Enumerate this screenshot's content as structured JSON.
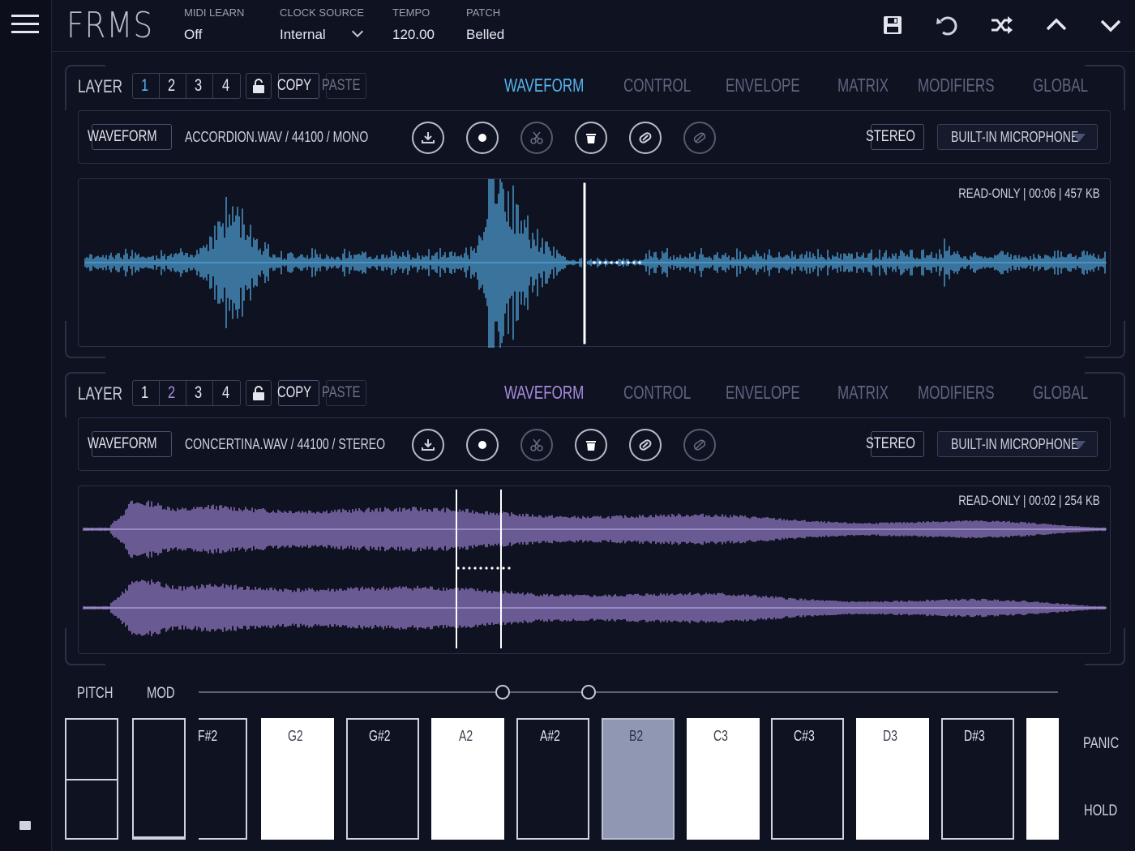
{
  "app": {
    "title": "FRMS"
  },
  "topbar": {
    "midi_learn": {
      "label": "MIDI LEARN",
      "value": "Off"
    },
    "clock_source": {
      "label": "CLOCK SOURCE",
      "value": "Internal"
    },
    "tempo": {
      "label": "TEMPO",
      "value": "120.00"
    },
    "patch": {
      "label": "PATCH",
      "value": "Belled"
    },
    "icons": [
      "save-icon",
      "undo-icon",
      "shuffle-icon",
      "chevron-up-icon",
      "chevron-down-icon"
    ]
  },
  "layers": [
    {
      "label": "LAYER",
      "numbers": [
        "1",
        "2",
        "3",
        "4"
      ],
      "selected_number": "1",
      "copy_label": "COPY",
      "paste_label": "PASTE",
      "tabs": [
        "WAVEFORM",
        "CONTROL",
        "ENVELOPE",
        "MATRIX",
        "MODIFIERS",
        "GLOBAL"
      ],
      "active_tab": "WAVEFORM",
      "accent": "#58b5ef",
      "waveform_button": "WAVEFORM",
      "file_info": "ACCORDION.WAV / 44100 / MONO",
      "stereo_label": "STEREO",
      "input_source": "BUILT-IN MICROPHONE",
      "wave_meta": "READ-ONLY  |  00:06  |  457 KB",
      "tool_icons": [
        "download-icon",
        "record-icon",
        "scissors-icon",
        "trash-icon",
        "link-icon",
        "unlink-icon"
      ]
    },
    {
      "label": "LAYER",
      "numbers": [
        "1",
        "2",
        "3",
        "4"
      ],
      "selected_number": "2",
      "copy_label": "COPY",
      "paste_label": "PASTE",
      "tabs": [
        "WAVEFORM",
        "CONTROL",
        "ENVELOPE",
        "MATRIX",
        "MODIFIERS",
        "GLOBAL"
      ],
      "active_tab": "WAVEFORM",
      "accent": "#a78be0",
      "waveform_button": "WAVEFORM",
      "file_info": "CONCERTINA.WAV / 44100 / STEREO",
      "stereo_label": "STEREO",
      "input_source": "BUILT-IN MICROPHONE",
      "wave_meta": "READ-ONLY  |  00:02  |  254 KB",
      "tool_icons": [
        "download-icon",
        "record-icon",
        "scissors-icon",
        "trash-icon",
        "link-icon",
        "unlink-icon"
      ]
    }
  ],
  "keyboard": {
    "pitch_label": "PITCH",
    "mod_label": "MOD",
    "keys": [
      {
        "note": "F#2",
        "color": "black"
      },
      {
        "note": "G2",
        "color": "white"
      },
      {
        "note": "G#2",
        "color": "black"
      },
      {
        "note": "A2",
        "color": "white"
      },
      {
        "note": "A#2",
        "color": "black"
      },
      {
        "note": "B2",
        "color": "highlight"
      },
      {
        "note": "C3",
        "color": "white"
      },
      {
        "note": "C#3",
        "color": "black"
      },
      {
        "note": "D3",
        "color": "white"
      },
      {
        "note": "D#3",
        "color": "black"
      }
    ],
    "panic_label": "PANIC",
    "hold_label": "HOLD"
  },
  "colors": {
    "background": "#0f1220",
    "blue_accent": "#58b5ef",
    "purple_accent": "#a78be0"
  }
}
